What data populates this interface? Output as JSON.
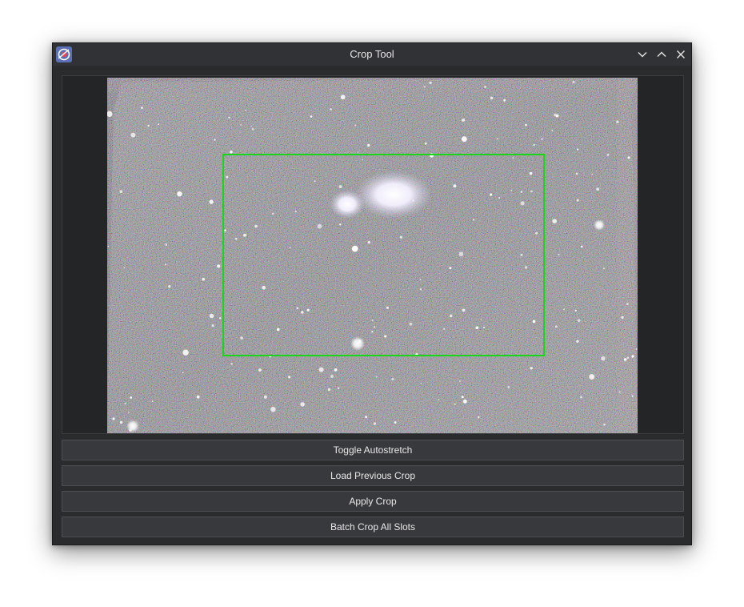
{
  "window": {
    "title": "Crop Tool",
    "app_icon": "siril-app-icon",
    "controls": {
      "minimize_icon": "chevron-down-icon",
      "maximize_icon": "chevron-up-icon",
      "close_icon": "close-icon"
    }
  },
  "viewer": {
    "image_description_icon": "astro-image",
    "crop_color": "#19d619"
  },
  "buttons": {
    "toggle_autostretch": "Toggle Autostretch",
    "load_previous_crop": "Load Previous Crop",
    "apply_crop": "Apply Crop",
    "batch_crop_all_slots": "Batch Crop All Slots"
  }
}
